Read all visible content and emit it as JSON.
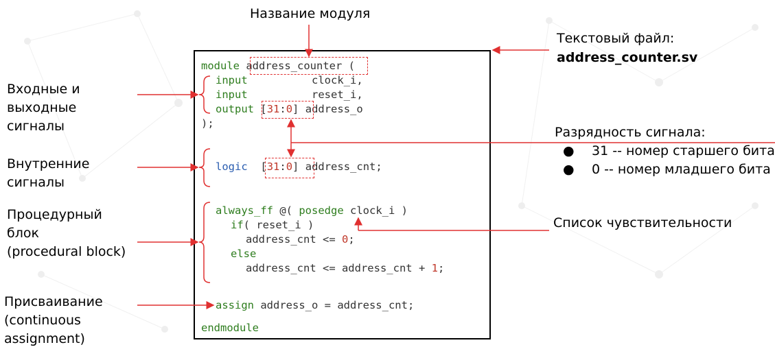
{
  "labels": {
    "module_name": "Название модуля",
    "file_caption": "Текстовый файл:",
    "file_name": "address_counter.sv",
    "io_signals": [
      "Входные и",
      "выходные",
      "сигналы"
    ],
    "internal_signals": [
      "Внутренние",
      "сигналы"
    ],
    "procedural_block": [
      "Процедурный",
      "блок",
      "(procedural block)"
    ],
    "assignment": [
      "Присваивание",
      "(continuous",
      "assignment)"
    ],
    "bit_width": "Разрядность сигнала:",
    "bit_width_items": [
      "31 -- номер старшего бита",
      "0 -- номер младшего бита"
    ],
    "sensitivity_list": "Список чувствительности"
  },
  "code": {
    "l1_kw": "module",
    "l1_name": "address_counter",
    "l1_rest": " (",
    "l2_kw": "input",
    "l2_sig": "clock_i,",
    "l3_kw": "input",
    "l3_sig": "reset_i,",
    "l4_kw": "output",
    "l4_open": "[",
    "l4_hi": "31",
    "l4_colon": ":",
    "l4_lo": "0",
    "l4_close": "]",
    "l4_sig": "address_o",
    "l5": ");",
    "l6_kw": "logic",
    "l6_open": "[",
    "l6_hi": "31",
    "l6_colon": ":",
    "l6_lo": "0",
    "l6_close": "]",
    "l6_sig": "address_cnt;",
    "l7_kw": "always_ff",
    "l7_mid": " @( ",
    "l7_kw2": "posedge",
    "l7_rest": " clock_i )",
    "l8_kw": "if",
    "l8_rest": "( reset_i )",
    "l9_text": "address_cnt <= ",
    "l9_num": "0",
    "l9_end": ";",
    "l10_kw": "else",
    "l11_text": "address_cnt <= address_cnt + ",
    "l11_num": "1",
    "l11_end": ";",
    "l12_kw": "assign",
    "l12_rest": " address_o = address_cnt;",
    "l13_kw": "endmodule"
  },
  "colors": {
    "keyword": "#2e7d1e",
    "type": "#2a5db0",
    "number": "#c0392b",
    "annotation": "#e03030"
  }
}
